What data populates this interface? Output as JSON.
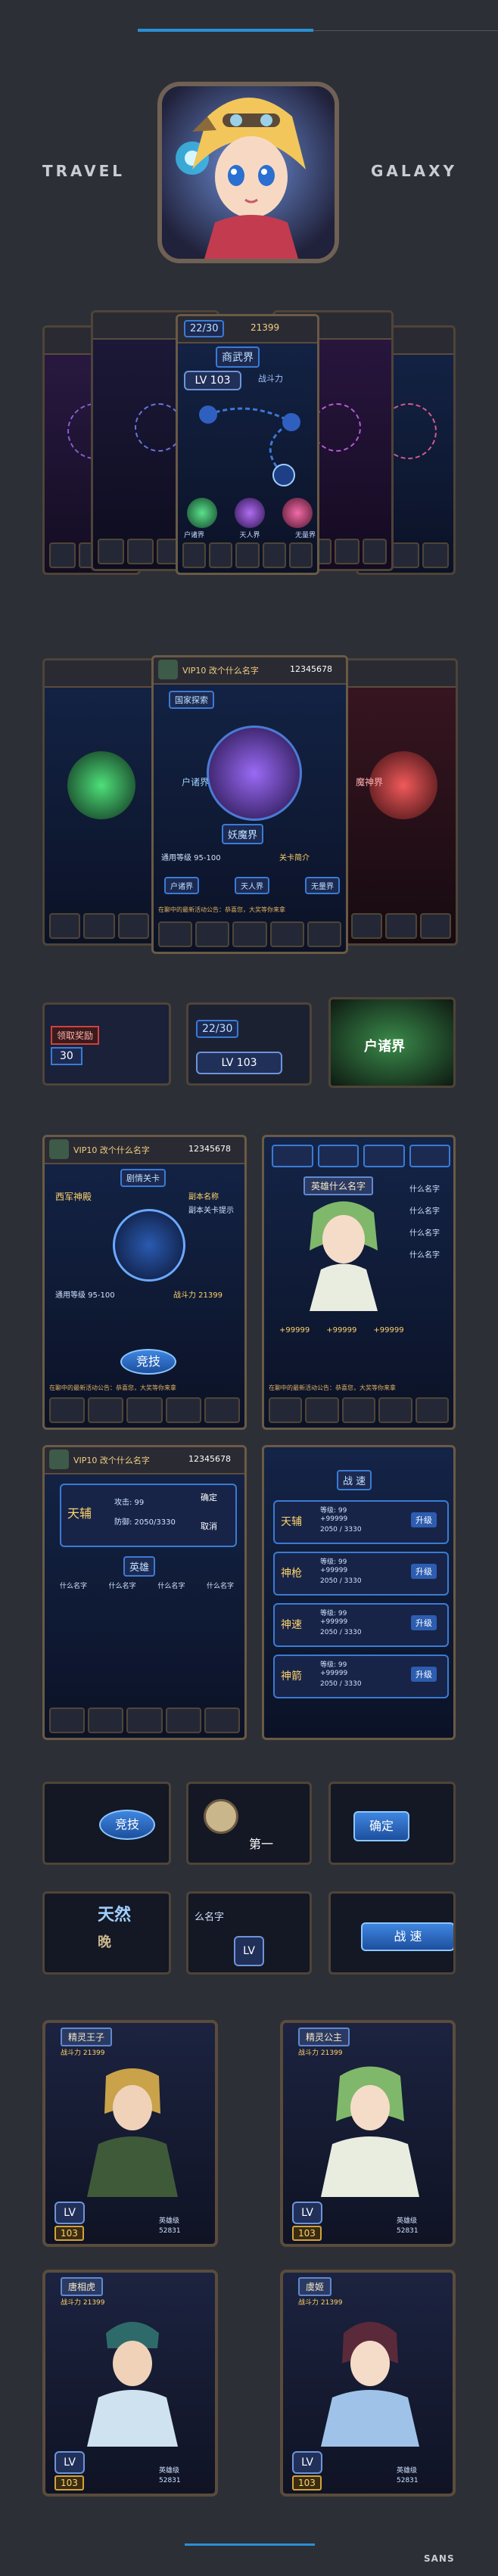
{
  "brand": {
    "left": "TRAVEL",
    "right": "GALAXY",
    "footer": "SANS"
  },
  "colors": {
    "accent": "#2a8fd6",
    "frame": "#5a4c3d",
    "gold": "#d3a23a"
  },
  "map_screen": {
    "title": "商武界",
    "energy": "22/30",
    "level_label": "LV",
    "level": "103",
    "power_label": "战斗力",
    "gold": "21399",
    "nav_labels": [
      "户诸界",
      "天人界",
      "无量界"
    ]
  },
  "world_screen": {
    "player_name": "VIP10 改个什么名字",
    "coins": "12345678",
    "section_label": "国家探索",
    "worlds": [
      "户诸界",
      "妖魔界",
      "魔神界"
    ],
    "world_labels": [
      "通用等级 95-100",
      "关卡简介"
    ],
    "tools": [
      "户诸界",
      "天人界",
      "无量界"
    ],
    "ticker": "在聊中的最新活动公告：恭喜您，大奖等你来拿"
  },
  "components": {
    "energy": "22/30",
    "lv": "LV",
    "lv_value": "103",
    "reward_label": "领取奖励",
    "reward_value": "30",
    "world_banner": "户诸界"
  },
  "arena_screen": {
    "player_name": "VIP10 改个什么名字",
    "coins": "12345678",
    "section": "剧情关卡",
    "heading": "西军神殿",
    "hint_title": "副本名称",
    "hint_body": "副本关卡提示",
    "level_req": "通用等级 95-100",
    "power": "战斗力 21399",
    "enter_btn": "竞技",
    "ticker": "在聊中的最新活动公告：恭喜您，大奖等你来拿"
  },
  "hero_screen": {
    "hero_name": "英雄什么名字",
    "slots": [
      "什么名字",
      "什么名字",
      "什么名字",
      "什么名字"
    ],
    "stats": [
      "+99999",
      "+99999",
      "+99999"
    ],
    "ticker": "在聊中的最新活动公告：恭喜您，大奖等你来拿"
  },
  "team_screen": {
    "player_name": "VIP10 改个什么名字",
    "coins": "12345678",
    "hero": "天辅",
    "stats": [
      "攻击: 99",
      "防御: 2050/3330"
    ],
    "confirm": "确定",
    "cancel": "取消",
    "slot_title": "英雄",
    "member_labels": [
      "什么名字",
      "什么名字",
      "什么名字",
      "什么名字"
    ]
  },
  "skill_screen": {
    "title": "战 速",
    "rows": [
      {
        "name": "天辅",
        "level": "等级: 99",
        "value": "+99999",
        "exp": "2050 / 3330",
        "btn": "升级"
      },
      {
        "name": "神枪",
        "level": "等级: 99",
        "value": "+99999",
        "exp": "2050 / 3330",
        "btn": "升级"
      },
      {
        "name": "神速",
        "level": "等级: 99",
        "value": "+99999",
        "exp": "2050 / 3330",
        "btn": "升级"
      },
      {
        "name": "神箭",
        "level": "等级: 99",
        "value": "+99999",
        "exp": "2050 / 3330",
        "btn": "升级"
      }
    ]
  },
  "widgets": {
    "arena": "竞技",
    "confirm": "确定",
    "mid_label": "第一",
    "name_label": "么名字",
    "lv": "LV",
    "sky_banner": "天然",
    "sky_sub": "晚",
    "battle": "战",
    "speed": "速"
  },
  "hero_cards": [
    {
      "name": "精灵王子",
      "power": "战斗力 21399",
      "lv": "LV",
      "level": "103",
      "gold": "52831",
      "tier": "英雄级"
    },
    {
      "name": "精灵公主",
      "power": "战斗力 21399",
      "lv": "LV",
      "level": "103",
      "gold": "52831",
      "tier": "英雄级"
    },
    {
      "name": "唐相虎",
      "power": "战斗力 21399",
      "lv": "LV",
      "level": "103",
      "gold": "52831",
      "tier": "英雄级"
    },
    {
      "name": "虞姬",
      "power": "战斗力 21399",
      "lv": "LV",
      "level": "103",
      "gold": "52831",
      "tier": "英雄级"
    }
  ]
}
